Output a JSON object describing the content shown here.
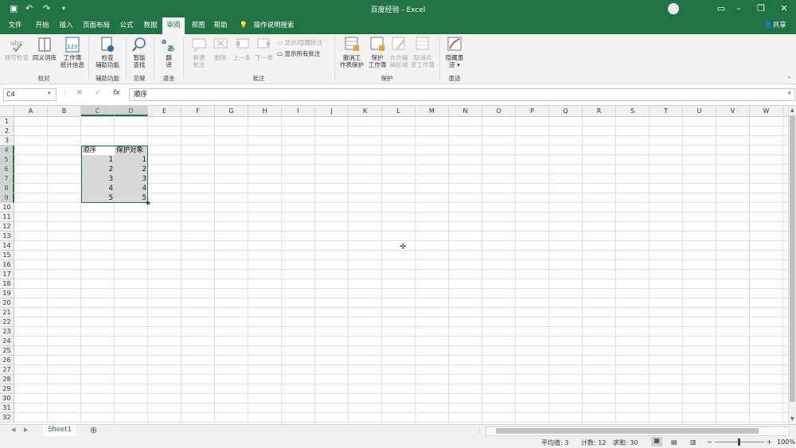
{
  "window": {
    "title": "百度经验 - Excel"
  },
  "tabs": [
    {
      "label": "文件"
    },
    {
      "label": "开始"
    },
    {
      "label": "插入"
    },
    {
      "label": "页面布局"
    },
    {
      "label": "公式"
    },
    {
      "label": "数据"
    },
    {
      "label": "审阅"
    },
    {
      "label": "视图"
    },
    {
      "label": "帮助"
    }
  ],
  "active_tab_index": 6,
  "tell_me": "操作说明搜索",
  "share": "共享",
  "ribbon": {
    "proof": {
      "spell": "拼写检查",
      "thesaurus": "同义词库",
      "stats1": "工作簿",
      "stats2": "统计信息",
      "group": "校对"
    },
    "access": {
      "check1": "检查",
      "check2": "辅助功能",
      "group": "辅助功能"
    },
    "insights": {
      "smart1": "智能",
      "smart2": "查找",
      "group": "见解"
    },
    "language": {
      "translate1": "翻",
      "translate2": "译",
      "group": "语言"
    },
    "comments": {
      "new1": "新建",
      "new2": "批注",
      "delete": "删除",
      "prev": "上一条",
      "next": "下一条",
      "show_hide": "显示/隐藏批注",
      "show_all": "显示所有批注",
      "group": "批注"
    },
    "protect": {
      "unprotect1": "撤消工",
      "unprotect2": "作表保护",
      "protect_wb1": "保护",
      "protect_wb2": "工作簿",
      "allow1": "允许编",
      "allow2": "辑区域",
      "unshare1": "取消共",
      "unshare2": "享工作簿",
      "group": "保护"
    },
    "ink": {
      "hide1": "隐藏墨",
      "hide2": "迹 ▾",
      "group": "墨迹"
    }
  },
  "formula_bar": {
    "name_box": "C4",
    "value": "顺序",
    "fx": "fx"
  },
  "columns": [
    "A",
    "B",
    "C",
    "D",
    "E",
    "F",
    "G",
    "H",
    "I",
    "J",
    "K",
    "L",
    "M",
    "N",
    "O",
    "P",
    "Q",
    "R",
    "S",
    "T",
    "U",
    "V",
    "W"
  ],
  "rows": [
    "1",
    "2",
    "3",
    "4",
    "5",
    "6",
    "7",
    "8",
    "9",
    "10",
    "11",
    "12",
    "13",
    "14",
    "15",
    "16",
    "17",
    "18",
    "19",
    "20",
    "21",
    "22",
    "23",
    "24",
    "25",
    "26",
    "27",
    "28",
    "29",
    "30",
    "31",
    "32"
  ],
  "table": {
    "headers": [
      "顺序",
      "保护对象"
    ],
    "rows": [
      [
        "1",
        "1"
      ],
      [
        "2",
        "2"
      ],
      [
        "3",
        "3"
      ],
      [
        "4",
        "4"
      ],
      [
        "5",
        "5"
      ]
    ]
  },
  "sheets": [
    {
      "name": "Sheet1"
    }
  ],
  "status": {
    "average": "平均值: 3",
    "count": "计数: 12",
    "sum": "求和: 30",
    "zoom": "100%"
  },
  "colors": {
    "accent": "#217346",
    "selection": "#d9d9d9"
  }
}
